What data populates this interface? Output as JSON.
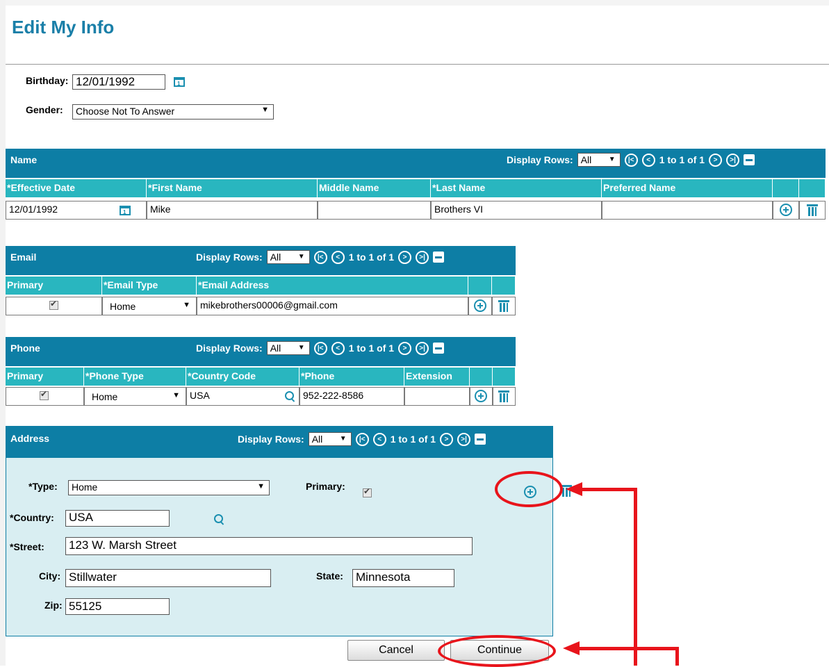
{
  "page": {
    "title": "Edit My Info"
  },
  "personal": {
    "birthday_label": "Birthday:",
    "birthday_value": "12/01/1992",
    "gender_label": "Gender:",
    "gender_value": "Choose Not To Answer"
  },
  "common": {
    "display_rows_label": "Display Rows:",
    "display_rows_value": "All",
    "pagination": "1 to 1 of 1"
  },
  "name_grid": {
    "title": "Name",
    "columns": [
      "*Effective Date",
      "*First Name",
      "Middle Name",
      "*Last Name",
      "Preferred Name"
    ],
    "row": {
      "effective_date": "12/01/1992",
      "first_name": "Mike",
      "middle_name": "",
      "last_name": "Brothers VI",
      "preferred_name": ""
    }
  },
  "email_grid": {
    "title": "Email",
    "columns": [
      "Primary",
      "*Email Type",
      "*Email Address"
    ],
    "row": {
      "primary": true,
      "type": "Home",
      "address": "mikebrothers00006@gmail.com"
    }
  },
  "phone_grid": {
    "title": "Phone",
    "columns": [
      "Primary",
      "*Phone Type",
      "*Country Code",
      "*Phone",
      "Extension"
    ],
    "row": {
      "primary": true,
      "type": "Home",
      "country_code": "USA",
      "phone": "952-222-8586",
      "extension": ""
    }
  },
  "address": {
    "title": "Address",
    "type_label": "*Type:",
    "type_value": "Home",
    "primary_label": "Primary:",
    "country_label": "*Country:",
    "country_value": "USA",
    "street_label": "*Street:",
    "street_value": "123 W. Marsh Street",
    "city_label": "City:",
    "city_value": "Stillwater",
    "state_label": "State:",
    "state_value": "Minnesota",
    "zip_label": "Zip:",
    "zip_value": "55125"
  },
  "buttons": {
    "cancel": "Cancel",
    "continue": "Continue"
  },
  "colors": {
    "header": "#0d7ea5",
    "subheader": "#29b6bf",
    "accent_red": "#e8141b",
    "title": "#1a7fa8"
  }
}
